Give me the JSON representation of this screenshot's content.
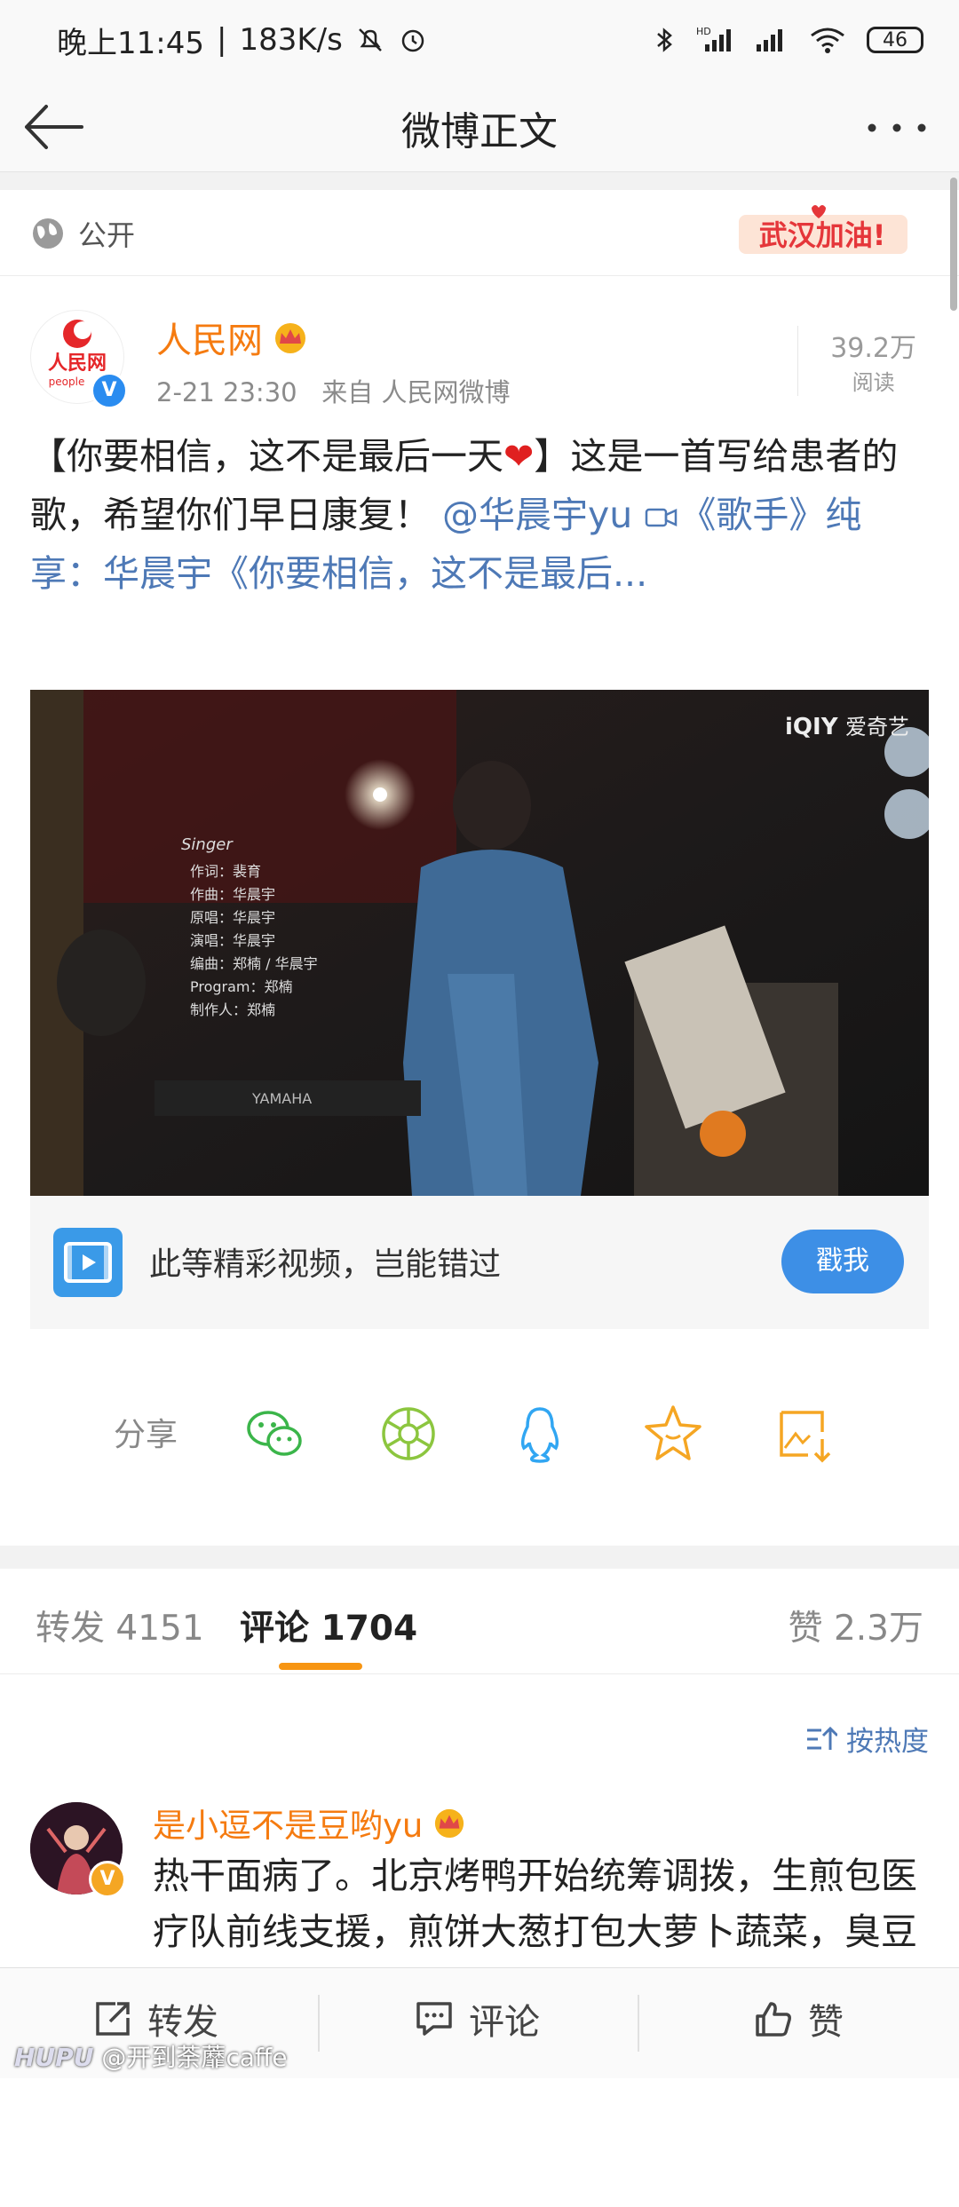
{
  "status": {
    "time": "晚上11:45",
    "speed": "183K/s",
    "battery": "46"
  },
  "nav": {
    "title": "微博正文"
  },
  "visibility": {
    "label": "公开",
    "badge": "武汉加油!"
  },
  "post": {
    "author": "人民网",
    "time": "2-21 23:30",
    "source": "来自 人民网微博",
    "reads_count": "39.2万",
    "reads_label": "阅读",
    "text_1": "【你要相信，这不是最后一天",
    "text_2": "】这是一首写给患者的歌，希望你们早日康复！",
    "mention": "@华晨宇yu",
    "video_link": "《歌手》纯享：华晨宇《你要相信，这不是最后...",
    "avatar_text": "人民网",
    "avatar_sub": "people"
  },
  "video": {
    "watermark": "爱奇艺",
    "brand": "iQIY",
    "signature": "Singer",
    "keyboard": "YAMAHA",
    "credits": [
      "作词：裴育",
      "作曲：华晨宇",
      "原唱：华晨宇",
      "演唱：华晨宇",
      "编曲：郑楠 / 华晨宇",
      "Program：郑楠",
      "制作人：郑楠"
    ]
  },
  "promo": {
    "text": "此等精彩视频，岂能错过",
    "button": "戳我"
  },
  "share": {
    "label": "分享"
  },
  "tabs": {
    "repost": "转发 4151",
    "comment": "评论 1704",
    "like": "赞 2.3万"
  },
  "comments": {
    "sort_label": "按热度",
    "items": [
      {
        "author": "是小逗不是豆哟yu",
        "text": "热干面病了。北京烤鸭开始统筹调拨，生煎包医疗队前线支援，煎饼大葱打包大萝卜蔬菜，臭豆腐捐赠医疗物资车队不停。我们都爱你呀，亲爱的热干面，你一定会好起来，然后我们"
      }
    ]
  },
  "bottom": {
    "repost": "转发",
    "comment": "评论",
    "like": "赞"
  },
  "watermark": {
    "brand": "HUPU",
    "text": "@开到荼蘼caffe"
  }
}
